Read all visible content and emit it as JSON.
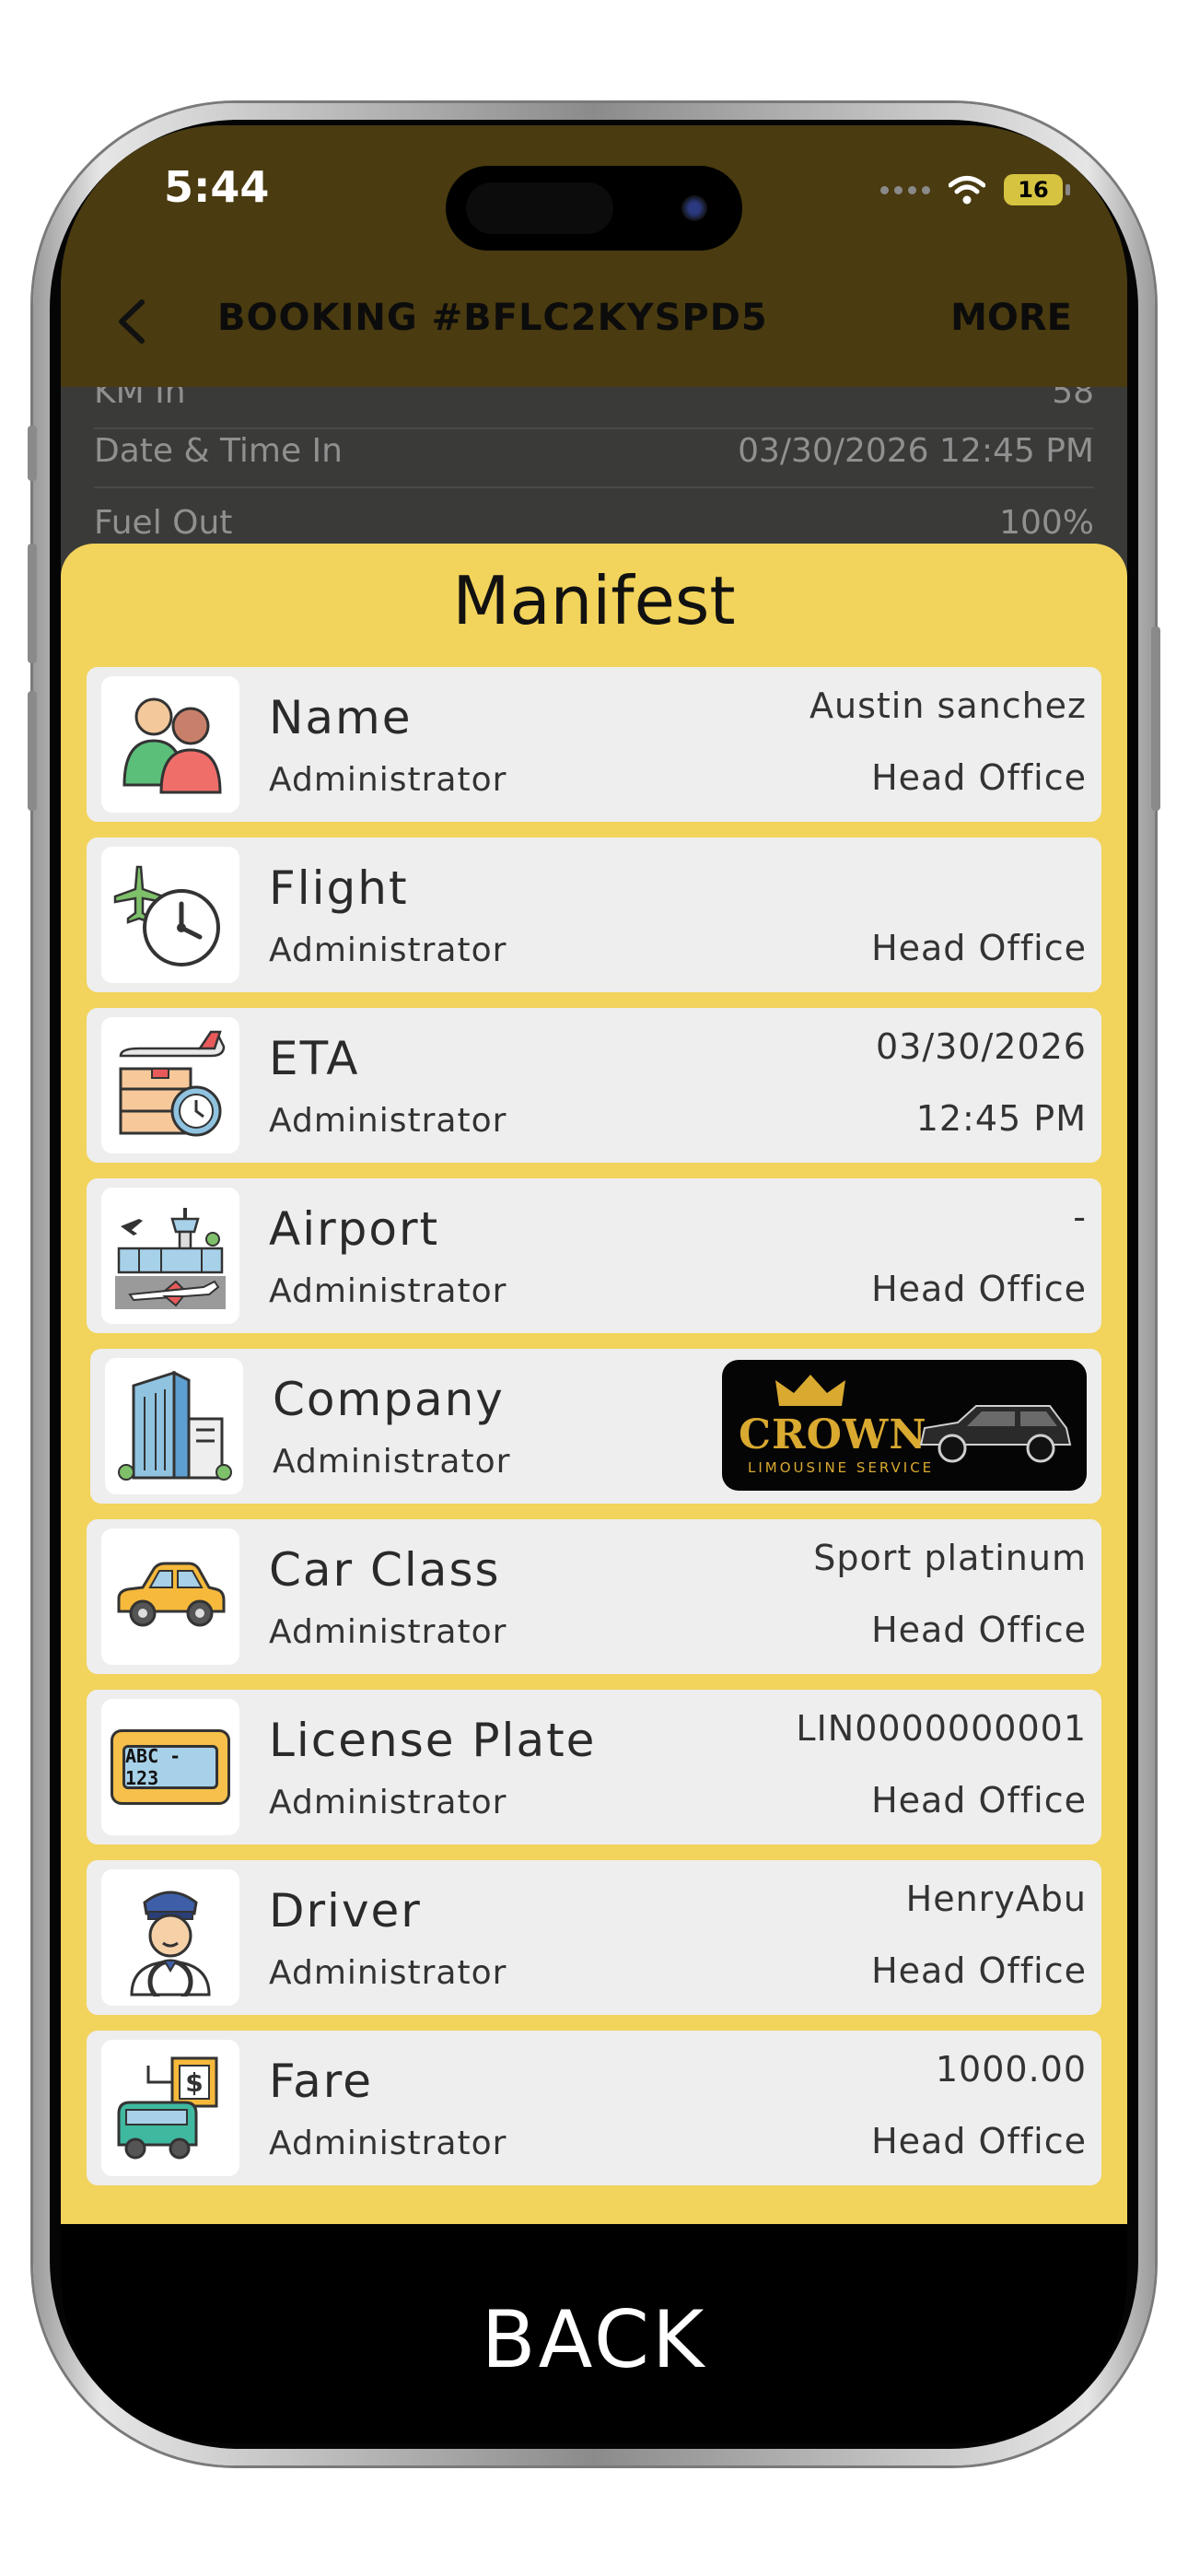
{
  "status_bar": {
    "time": "5:44",
    "battery": "16"
  },
  "header": {
    "title": "BOOKING #BFLC2KYSPD5",
    "more_label": "MORE"
  },
  "background_rows": [
    {
      "label": "KM In",
      "value": "58"
    },
    {
      "label": "Date & Time In",
      "value": "03/30/2026 12:45 PM"
    },
    {
      "label": "Fuel Out",
      "value": "100%"
    }
  ],
  "manifest": {
    "title": "Manifest",
    "items": [
      {
        "label": "Name",
        "sub": "Administrator",
        "value": "Austin sanchez",
        "sub_value": "Head Office",
        "icon": "people-icon"
      },
      {
        "label": "Flight",
        "sub": "Administrator",
        "value": "",
        "sub_value": "Head Office",
        "icon": "flight-clock-icon"
      },
      {
        "label": "ETA",
        "sub": "Administrator",
        "value": "03/30/2026",
        "sub_value": "12:45 PM",
        "icon": "eta-icon"
      },
      {
        "label": "Airport",
        "sub": "Administrator",
        "value": "-",
        "sub_value": "Head Office",
        "icon": "airport-icon"
      },
      {
        "label": "Company",
        "sub": "Administrator",
        "logo_text": "CROWN",
        "logo_subtext": "LIMOUSINE SERVICE",
        "icon": "building-icon"
      },
      {
        "label": "Car Class",
        "sub": "Administrator",
        "value": "Sport platinum",
        "sub_value": "Head Office",
        "icon": "car-icon"
      },
      {
        "label": "License Plate",
        "sub": "Administrator",
        "value": "LIN0000000001",
        "sub_value": "Head Office",
        "plate_text": "ABC - 123",
        "icon": "license-plate-icon"
      },
      {
        "label": "Driver",
        "sub": "Administrator",
        "value": "HenryAbu",
        "sub_value": "Head Office",
        "icon": "driver-icon"
      },
      {
        "label": "Fare",
        "sub": "Administrator",
        "value": "1000.00",
        "sub_value": "Head Office",
        "fare_symbol": "$",
        "icon": "fare-icon"
      }
    ]
  },
  "footer": {
    "back_label": "BACK"
  },
  "colors": {
    "accent": "#f2d35c",
    "header": "#4a3b10",
    "card": "#eeeeee"
  }
}
